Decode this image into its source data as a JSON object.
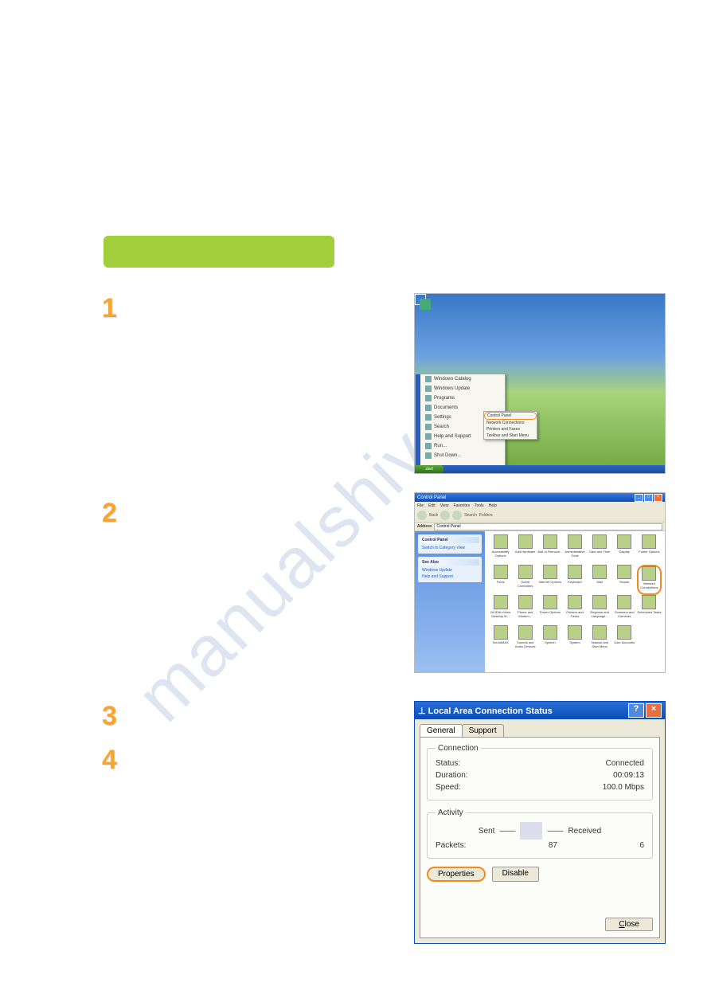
{
  "watermark": "manualshive.com",
  "steps": {
    "n1": "1",
    "n2": "2",
    "n3": "3",
    "n4": "4"
  },
  "shot1": {
    "start": "start",
    "menu": {
      "catalog": "Windows Catalog",
      "update": "Windows Update",
      "programs": "Programs",
      "documents": "Documents",
      "settings": "Settings",
      "search": "Search",
      "help": "Help and Support",
      "run": "Run...",
      "shutdown": "Shut Down..."
    },
    "submenu": {
      "control_panel": "Control Panel",
      "network": "Network Connections",
      "printers": "Printers and Faxes",
      "taskbar": "Taskbar and Start Menu"
    }
  },
  "shot2": {
    "title": "Control Panel",
    "menu": {
      "file": "File",
      "edit": "Edit",
      "view": "View",
      "favorites": "Favorites",
      "tools": "Tools",
      "help": "Help"
    },
    "toolbar": {
      "back": "Back",
      "search": "Search",
      "folders": "Folders"
    },
    "address_label": "Address",
    "address_value": "Control Panel",
    "left": {
      "box1_title": "Control Panel",
      "box1_item": "Switch to Category View",
      "box2_title": "See Also",
      "box2_item1": "Windows Update",
      "box2_item2": "Help and Support"
    },
    "icons": [
      "Accessibility Options",
      "Add Hardware",
      "Add or Remove...",
      "Administrative Tools",
      "Date and Time",
      "Display",
      "Folder Options",
      "Fonts",
      "Game Controllers",
      "Internet Options",
      "Keyboard",
      "Mail",
      "Mouse",
      "Network Connections",
      "NVIDIA nView Desktop M...",
      "Phone and Modem...",
      "Power Options",
      "Printers and Faxes",
      "Regional and Language...",
      "Scanners and Cameras",
      "Scheduled Tasks",
      "SoundMAX",
      "Sounds and Audio Devices",
      "Speech",
      "System",
      "Taskbar and Start Menu",
      "User Accounts"
    ],
    "highlight_index": 13
  },
  "shot3": {
    "title": "Local Area Connection Status",
    "tabs": {
      "general": "General",
      "support": "Support"
    },
    "connection": {
      "legend": "Connection",
      "status_label": "Status:",
      "status_value": "Connected",
      "duration_label": "Duration:",
      "duration_value": "00:09:13",
      "speed_label": "Speed:",
      "speed_value": "100.0 Mbps"
    },
    "activity": {
      "legend": "Activity",
      "sent_label": "Sent",
      "received_label": "Received",
      "packets_label": "Packets:",
      "sent_value": "87",
      "received_value": "6"
    },
    "buttons": {
      "properties": "Properties",
      "disable": "Disable",
      "close_prefix": "",
      "close_u": "C",
      "close_rest": "lose"
    }
  }
}
